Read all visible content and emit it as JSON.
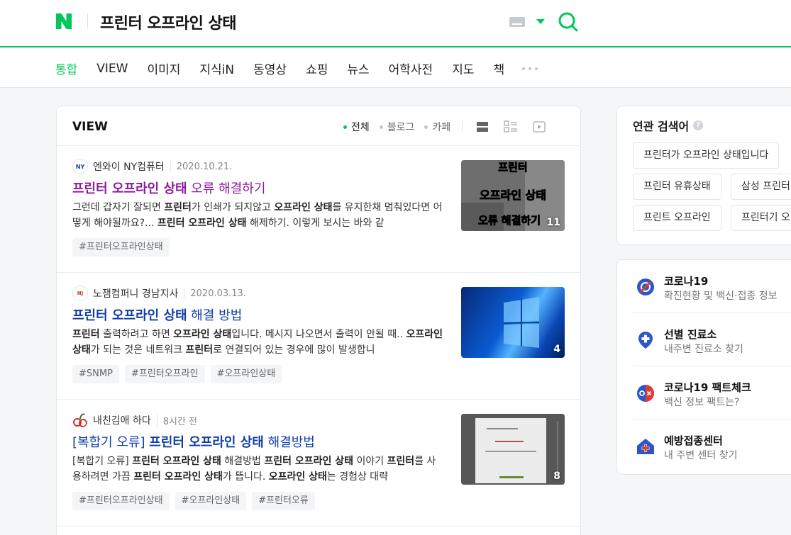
{
  "header": {
    "logo": "N",
    "query": "프린터 오프라인 상태",
    "keyboard_icon": "keyboard-icon",
    "search_icon": "search-icon",
    "accent": "#03c75a"
  },
  "tabs": [
    {
      "label": "통합",
      "active": true
    },
    {
      "label": "VIEW"
    },
    {
      "label": "이미지"
    },
    {
      "label": "지식iN"
    },
    {
      "label": "동영상"
    },
    {
      "label": "쇼핑"
    },
    {
      "label": "뉴스"
    },
    {
      "label": "어학사전"
    },
    {
      "label": "지도"
    },
    {
      "label": "책"
    }
  ],
  "view": {
    "title": "VIEW",
    "filters": [
      {
        "label": "전체",
        "active": true
      },
      {
        "label": "블로그"
      },
      {
        "label": "카페"
      }
    ],
    "items": [
      {
        "author": "엔와이 NY컴퓨터",
        "avatar_text": "NY",
        "date": "2020.10.21.",
        "title_bold": "프린터 오프라인 상태",
        "title_rest": " 오류 해결하기",
        "desc": "그런데 갑자기 잘되면 프린터가 인쇄가 되지않고 오프라인 상태를 유지한채 멈춰있다면 어떻게 해야될까요?... 프린터 오프라인 상태 해제하기. 이렇게 보시는 바와 같",
        "tags": [
          "#프린터오프라인상태"
        ],
        "thumb_text": "프린터 오프라인 상태 오류 해결하기",
        "thumb_count": "11"
      },
      {
        "author": "노잼컴퍼니 경남지사",
        "avatar_text": "NJ",
        "date": "2020.03.13.",
        "title_bold": "프린터 오프라인 상태",
        "title_rest": " 해결 방법",
        "desc": "프린터 출력하려고 하면 오프라인 상태입니다. 메시지 나오면서 출력이 안될 때.. 오프라인 상태가 되는 것은 네트워크 프린터로 연결되어 있는 경우에 많이 발생합니",
        "tags": [
          "#SNMP",
          "#프린터오프라인",
          "#오프라인상태"
        ],
        "thumb_count": "4"
      },
      {
        "author": "내친김애 하다",
        "date": "8시간 전",
        "title_pre": "[복합기 오류] ",
        "title_bold": "프린터 오프라인 상태",
        "title_rest": " 해결방법",
        "desc": "[복합기 오류] 프린터 오프라인 상태 해결방법 프린터 오프라인 상태 이야기 프린터를 사용하려면 가끔 프린터 오프라인 상태가 뜹니다. 오프라인 상태는 경험상 대략",
        "tags": [
          "#프린터오프라인상태",
          "#오프라인상태",
          "#프린터오류"
        ],
        "thumb_count": "8"
      }
    ]
  },
  "related": {
    "title": "연관 검색어",
    "help": "?",
    "chips": [
      "프린터가 오프라인 상태입니다",
      "프린터 유휴상태",
      "삼성 프린터",
      "프린트 오프라인",
      "프린터기 오"
    ]
  },
  "info": [
    {
      "title": "코로나19",
      "sub": "확진현황 및 백신·접종 정보",
      "icon": "virus-icon"
    },
    {
      "title": "선별 진료소",
      "sub": "내주변 진료소 찾기",
      "icon": "clinic-pin-icon"
    },
    {
      "title": "코로나19 팩트체크",
      "sub": "백신 정보 팩트는?",
      "icon": "ox-icon"
    },
    {
      "title": "예방접종센터",
      "sub": "내 주변 센터 찾기",
      "icon": "vaccine-center-icon"
    }
  ]
}
